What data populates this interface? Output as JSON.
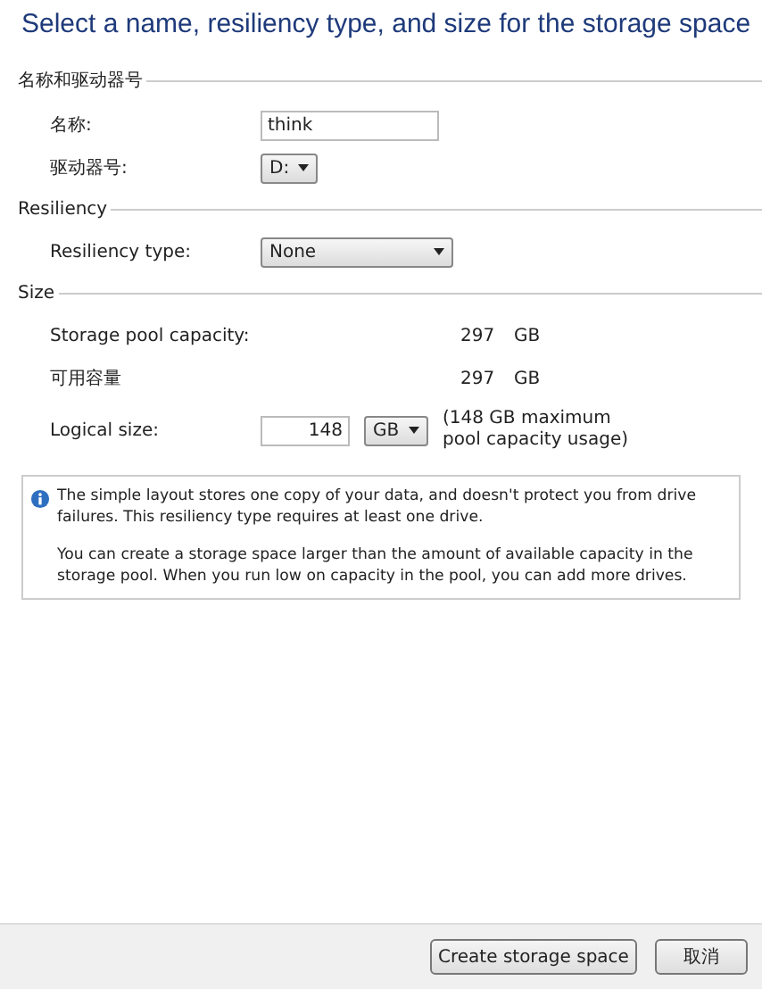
{
  "title": "Select a name, resiliency type, and size for the storage space",
  "sections": [
    {
      "heading": "名称和驱动器号",
      "rows": [
        {
          "kind": "text",
          "label": "名称:",
          "value": "think"
        },
        {
          "kind": "select",
          "label": "驱动器号:",
          "value": "D:"
        }
      ]
    },
    {
      "heading": "Resiliency",
      "rows": [
        {
          "kind": "select",
          "label": "Resiliency type:",
          "value": "None"
        }
      ]
    },
    {
      "heading": "Size",
      "rows": [
        {
          "kind": "readout",
          "label": "Storage pool capacity:",
          "value": "297",
          "unit": "GB"
        },
        {
          "kind": "readout",
          "label": "可用容量",
          "value": "297",
          "unit": "GB"
        },
        {
          "kind": "size",
          "label": "Logical size:",
          "value": "148",
          "unit": "GB",
          "note": "(148 GB maximum pool capacity usage)"
        }
      ]
    }
  ],
  "info": [
    "The simple layout stores one copy of your data, and doesn't protect you from drive failures. This resiliency type requires at least one drive.",
    "You can create a storage space larger than the amount of available capacity in the storage pool. When you run low on capacity in the pool, you can add more drives."
  ],
  "buttons": [
    "Create storage space",
    "取消"
  ]
}
